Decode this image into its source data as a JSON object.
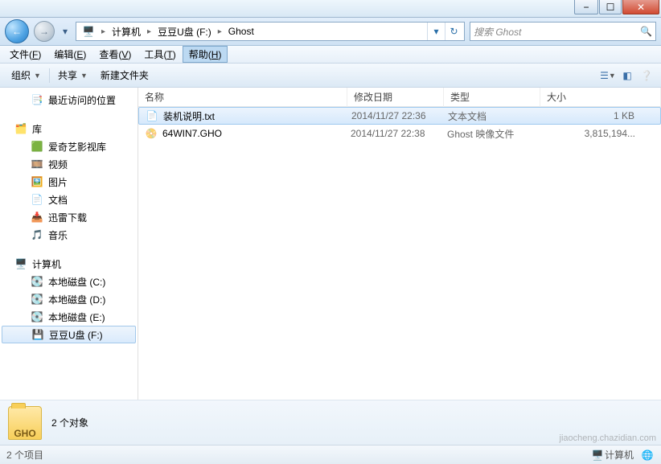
{
  "window": {
    "minimize": "−",
    "maximize": "☐",
    "close": "✕"
  },
  "nav": {
    "back": "←",
    "forward": "→"
  },
  "breadcrumbs": [
    {
      "icon": "computer",
      "label": "计算机"
    },
    {
      "label": "豆豆U盘 (F:)"
    },
    {
      "label": "Ghost"
    }
  ],
  "search": {
    "placeholder": "搜索 Ghost"
  },
  "menu": [
    {
      "label": "文件",
      "key": "F"
    },
    {
      "label": "编辑",
      "key": "E"
    },
    {
      "label": "查看",
      "key": "V"
    },
    {
      "label": "工具",
      "key": "T"
    },
    {
      "label": "帮助",
      "key": "H",
      "active": true
    }
  ],
  "toolbar": {
    "organize": "组织",
    "share": "共享",
    "newfolder": "新建文件夹"
  },
  "sidebar": {
    "recent": "最近访问的位置",
    "libraries": "库",
    "lib_items": [
      "爱奇艺影视库",
      "视频",
      "图片",
      "文档",
      "迅雷下载",
      "音乐"
    ],
    "computer": "计算机",
    "drives": [
      "本地磁盘 (C:)",
      "本地磁盘 (D:)",
      "本地磁盘 (E:)",
      "豆豆U盘 (F:)"
    ]
  },
  "columns": {
    "name": "名称",
    "date": "修改日期",
    "type": "类型",
    "size": "大小"
  },
  "files": [
    {
      "name": "装机说明.txt",
      "date": "2014/11/27 22:36",
      "type": "文本文档",
      "size": "1 KB",
      "icon": "txt",
      "selected": true
    },
    {
      "name": "64WIN7.GHO",
      "date": "2014/11/27 22:38",
      "type": "Ghost 映像文件",
      "size": "3,815,194...",
      "icon": "gho",
      "selected": false
    }
  ],
  "details": {
    "count": "2 个对象",
    "folderlabel": "GHO"
  },
  "status": {
    "items": "2 个项目",
    "computer": "计算机"
  },
  "watermark": "jiaocheng.chazidian.com"
}
